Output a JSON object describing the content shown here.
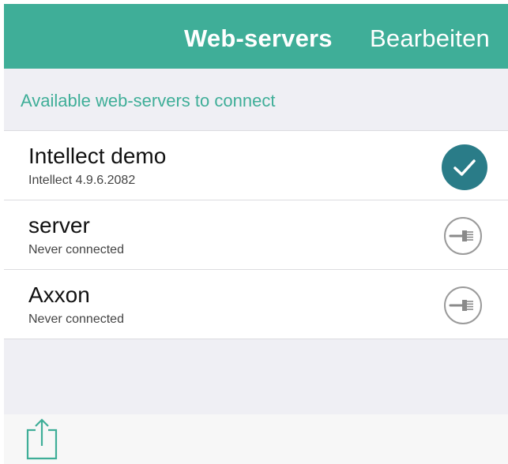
{
  "navbar": {
    "title": "Web-servers",
    "edit_label": "Bearbeiten",
    "background_color": "#3fae98"
  },
  "section": {
    "header": "Available web-servers to connect"
  },
  "servers": [
    {
      "name": "Intellect demo",
      "subtitle": "Intellect 4.9.6.2082",
      "status": "connected",
      "icon": "checkmark-icon"
    },
    {
      "name": "server",
      "subtitle": "Never connected",
      "status": "not-connected",
      "icon": "plug-icon"
    },
    {
      "name": "Axxon",
      "subtitle": "Never connected",
      "status": "not-connected",
      "icon": "plug-icon"
    }
  ],
  "toolbar": {
    "share_icon": "share-icon"
  },
  "colors": {
    "accent": "#3fae98",
    "section_bg": "#efeff4",
    "checkmark_fill": "#2a7c88"
  }
}
